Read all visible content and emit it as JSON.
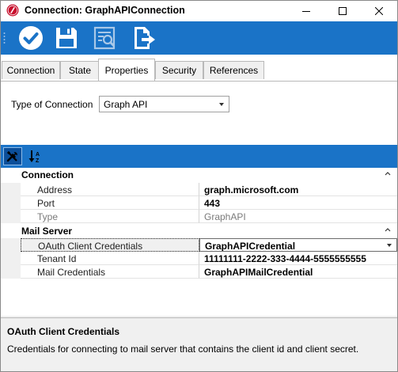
{
  "window": {
    "title": "Connection: GraphAPIConnection",
    "app_icon": "app-logo-icon",
    "controls": [
      "minimize-icon",
      "maximize-icon",
      "close-icon"
    ]
  },
  "toolbar": {
    "buttons": [
      {
        "name": "save-and-close-button",
        "icon": "checkmark-circle-icon"
      },
      {
        "name": "save-button",
        "icon": "floppy-disk-icon"
      },
      {
        "name": "preview-button",
        "icon": "document-search-icon"
      },
      {
        "name": "export-button",
        "icon": "export-arrow-icon"
      }
    ]
  },
  "tabs": [
    {
      "label": "Connection",
      "active": false
    },
    {
      "label": "State",
      "active": false
    },
    {
      "label": "Properties",
      "active": true
    },
    {
      "label": "Security",
      "active": false
    },
    {
      "label": "References",
      "active": false
    }
  ],
  "type_of_connection": {
    "label": "Type of Connection",
    "value": "Graph API"
  },
  "property_grid": {
    "toolbar": [
      {
        "name": "categorized-button",
        "icon": "tools-icon",
        "selected": true
      },
      {
        "name": "sort-alphabetical-button",
        "icon": "sort-az-icon",
        "selected": false
      }
    ],
    "categories": [
      {
        "name": "Connection",
        "properties": [
          {
            "name": "Address",
            "value": "graph.microsoft.com",
            "readonly": false
          },
          {
            "name": "Port",
            "value": "443",
            "readonly": false
          },
          {
            "name": "Type",
            "value": "GraphAPI",
            "readonly": true
          }
        ]
      },
      {
        "name": "Mail Server",
        "properties": [
          {
            "name": "OAuth Client Credentials",
            "value": "GraphAPICredential",
            "readonly": false,
            "selected": true
          },
          {
            "name": "Tenant Id",
            "value": "11111111-2222-333-4444-5555555555",
            "readonly": false
          },
          {
            "name": "Mail Credentials",
            "value": "GraphAPIMailCredential",
            "readonly": false
          }
        ]
      }
    ]
  },
  "description": {
    "title": "OAuth Client Credentials",
    "text": "Credentials for connecting to mail server that contains the client id and client secret."
  },
  "colors": {
    "toolbar_blue": "#1a73c7",
    "app_icon_red": "#c8102e"
  }
}
